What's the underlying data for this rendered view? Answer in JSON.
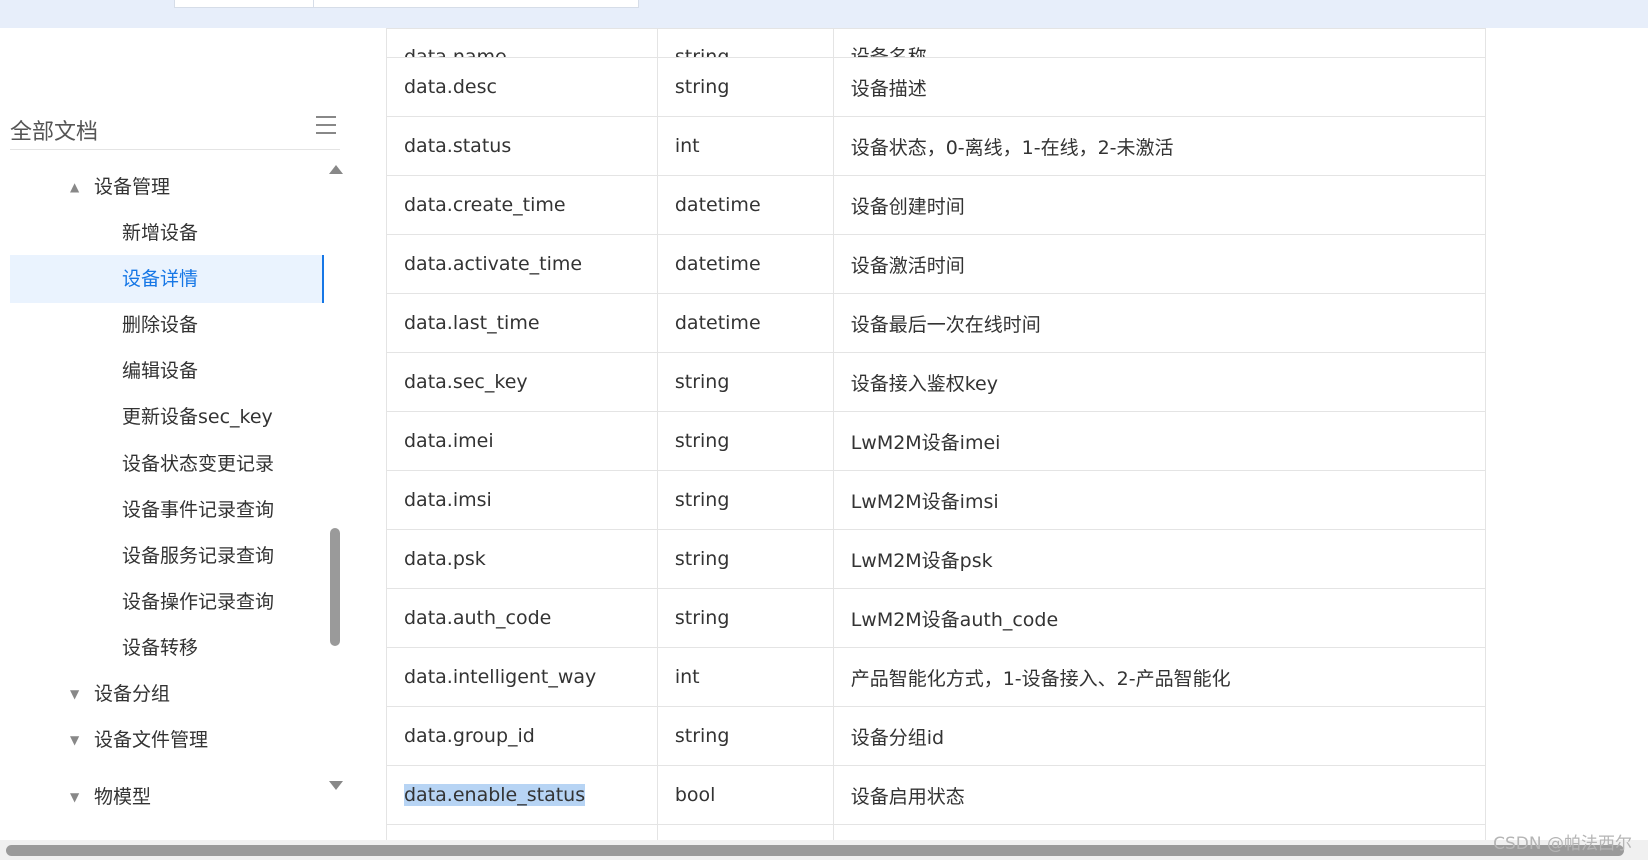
{
  "sidebar": {
    "title": "全部文档",
    "menu_icon": "hamburger-menu-icon",
    "items": [
      {
        "label": "设备管理",
        "type": "parent",
        "expanded": true
      },
      {
        "label": "新增设备",
        "type": "child"
      },
      {
        "label": "设备详情",
        "type": "child",
        "active": true
      },
      {
        "label": "删除设备",
        "type": "child"
      },
      {
        "label": "编辑设备",
        "type": "child"
      },
      {
        "label": "更新设备sec_key",
        "type": "child"
      },
      {
        "label": "设备状态变更记录",
        "type": "child"
      },
      {
        "label": "设备事件记录查询",
        "type": "child"
      },
      {
        "label": "设备服务记录查询",
        "type": "child"
      },
      {
        "label": "设备操作记录查询",
        "type": "child"
      },
      {
        "label": "设备转移",
        "type": "child"
      },
      {
        "label": "设备分组",
        "type": "parent",
        "expanded": false
      },
      {
        "label": "设备文件管理",
        "type": "parent",
        "expanded": false
      },
      {
        "label": "物模型",
        "type": "parent",
        "expanded": false,
        "partially_visible": true
      }
    ]
  },
  "table": {
    "rows": [
      {
        "name": "data.name",
        "type": "string",
        "desc": "设备名称"
      },
      {
        "name": "data.desc",
        "type": "string",
        "desc": "设备描述"
      },
      {
        "name": "data.status",
        "type": "int",
        "desc": "设备状态，0-离线，1-在线，2-未激活"
      },
      {
        "name": "data.create_time",
        "type": "datetime",
        "desc": "设备创建时间"
      },
      {
        "name": "data.activate_time",
        "type": "datetime",
        "desc": "设备激活时间"
      },
      {
        "name": "data.last_time",
        "type": "datetime",
        "desc": "设备最后一次在线时间"
      },
      {
        "name": "data.sec_key",
        "type": "string",
        "desc": "设备接入鉴权key"
      },
      {
        "name": "data.imei",
        "type": "string",
        "desc": "LwM2M设备imei"
      },
      {
        "name": "data.imsi",
        "type": "string",
        "desc": "LwM2M设备imsi"
      },
      {
        "name": "data.psk",
        "type": "string",
        "desc": "LwM2M设备psk"
      },
      {
        "name": "data.auth_code",
        "type": "string",
        "desc": "LwM2M设备auth_code"
      },
      {
        "name": "data.intelligent_way",
        "type": "int",
        "desc": "产品智能化方式，1-设备接入、2-产品智能化"
      },
      {
        "name": "data.group_id",
        "type": "string",
        "desc": "设备分组id"
      },
      {
        "name": "data.enable_status",
        "type": "bool",
        "desc": "设备启用状态",
        "selected": true
      },
      {
        "name": "",
        "type": "",
        "desc": ""
      }
    ]
  },
  "watermark": "CSDN @帕法西尔",
  "colors": {
    "accent": "#1677e6",
    "active_bg": "#eaf3fe",
    "selection": "#b7d4f4",
    "topbar": "#e7eefa"
  }
}
